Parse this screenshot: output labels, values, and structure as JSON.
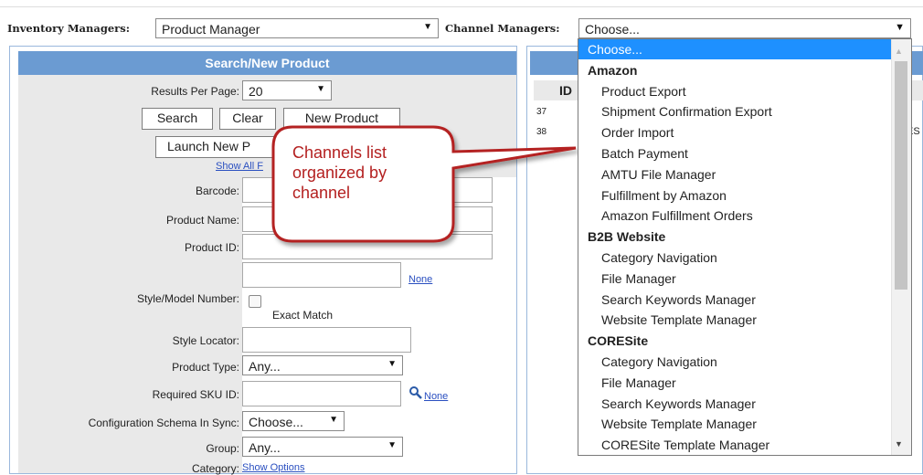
{
  "topbar": {
    "inventory_label": "Inventory Managers:",
    "inventory_value": "Product Manager",
    "channel_label": "Channel Managers:",
    "channel_value": "Choose..."
  },
  "search_panel": {
    "title": "Search/New Product",
    "results_label": "Results Per Page:",
    "results_value": "20",
    "search_btn": "Search",
    "clear_btn": "Clear",
    "new_product_btn": "New Product",
    "launch_btn": "Launch New P",
    "show_all_link": "Show All F",
    "barcode_label": "Barcode:",
    "product_name_label": "Product Name:",
    "product_id_label": "Product ID:",
    "style_model_label": "Style/Model Number:",
    "style_none_link": "None",
    "exact_match": "Exact Match",
    "style_locator_label": "Style Locator:",
    "product_type_label": "Product Type:",
    "product_type_value": "Any...",
    "required_sku_label": "Required SKU ID:",
    "sku_none_link": "None",
    "config_schema_label": "Configuration Schema In Sync:",
    "config_schema_value": "Choose...",
    "group_label": "Group:",
    "group_value": "Any...",
    "category_label": "Category:",
    "category_link": "Show Options"
  },
  "right_panel": {
    "col_header": "ID",
    "rows": [
      "37",
      "38"
    ],
    "row_overflow": "ES"
  },
  "callout": {
    "text_line1": "Channels list",
    "text_line2": "organized by",
    "text_line3": "channel"
  },
  "dropdown": {
    "items": [
      {
        "label": "Choose...",
        "kind": "highlight"
      },
      {
        "label": "Amazon",
        "kind": "group"
      },
      {
        "label": "Product Export",
        "kind": "option"
      },
      {
        "label": "Shipment Confirmation Export",
        "kind": "option"
      },
      {
        "label": "Order Import",
        "kind": "option"
      },
      {
        "label": "Batch Payment",
        "kind": "option"
      },
      {
        "label": "AMTU File Manager",
        "kind": "option"
      },
      {
        "label": "Fulfillment by Amazon",
        "kind": "option"
      },
      {
        "label": "Amazon Fulfillment Orders",
        "kind": "option"
      },
      {
        "label": "B2B Website",
        "kind": "group"
      },
      {
        "label": "Category Navigation",
        "kind": "option"
      },
      {
        "label": "File Manager",
        "kind": "option"
      },
      {
        "label": "Search Keywords Manager",
        "kind": "option"
      },
      {
        "label": "Website Template Manager",
        "kind": "option"
      },
      {
        "label": "CORESite",
        "kind": "group"
      },
      {
        "label": "Category Navigation",
        "kind": "option"
      },
      {
        "label": "File Manager",
        "kind": "option"
      },
      {
        "label": "Search Keywords Manager",
        "kind": "option"
      },
      {
        "label": "Website Template Manager",
        "kind": "option"
      },
      {
        "label": "CORESite Template Manager",
        "kind": "option"
      }
    ]
  },
  "colors": {
    "panel_header": "#6b9bd2",
    "highlight": "#1e90ff",
    "callout_border": "#b42020"
  }
}
